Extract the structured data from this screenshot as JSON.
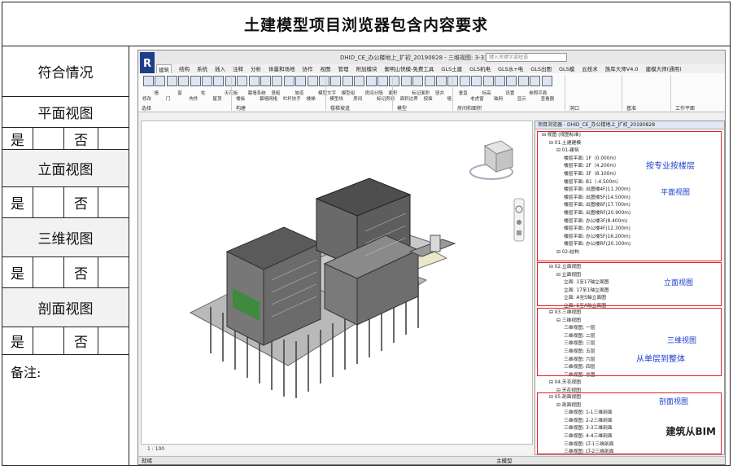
{
  "title": "土建模型项目浏览器包含内容要求",
  "left_panel": {
    "header": "符合情况",
    "sections": [
      {
        "label": "平面视图",
        "yes": "是",
        "no": "否"
      },
      {
        "label": "立面视图",
        "yes": "是",
        "no": "否"
      },
      {
        "label": "三维视图",
        "yes": "是",
        "no": "否"
      },
      {
        "label": "剖面视图",
        "yes": "是",
        "no": "否"
      }
    ],
    "note": "备注:"
  },
  "revit": {
    "logo": "R",
    "window_title": "DHID_CE_办公楼地上_扩初_20190828 - 三维视图: 3-3三维剖面",
    "search_placeholder": "键入关键字或短语",
    "tabs": [
      "建筑",
      "结构",
      "系统",
      "插入",
      "注释",
      "分析",
      "体量和场地",
      "协作",
      "视图",
      "管理",
      "附加模块",
      "衡明山快模-免费工具",
      "GLS土建",
      "GLS机电",
      "GLS水+电",
      "GLS出图",
      "GLS模",
      "云技术",
      "族库大师V4.0",
      "建模大师(通用)"
    ],
    "active_tab": "建筑",
    "ribbon_buttons": [
      "修改",
      "墙",
      "门",
      "窗",
      "构件",
      "柱",
      "屋顶",
      "天花板",
      "楼板",
      "幕墙系统",
      "幕墙网格",
      "竖梃",
      "栏杆扶手",
      "坡道",
      "楼梯",
      "模型文字",
      "模型线",
      "模型组",
      "房间",
      "房间分隔",
      "标记房间",
      "面积",
      "面积边界",
      "标记面积",
      "按面",
      "竖井",
      "墙",
      "垂直",
      "老虎窗",
      "标高",
      "轴网",
      "设置",
      "显示",
      "参照平面",
      "查看器"
    ],
    "ribbon_groups": [
      "选择",
      "构建",
      "楼梯坡道",
      "模型",
      "房间和面积",
      "洞口",
      "基准",
      "工作平面"
    ],
    "view_scale": "1 : 100",
    "status": "就绪",
    "status_right": "主模型",
    "browser": {
      "header": "项目浏览器 - DHID_CE_办公楼地上_扩初_20190828",
      "items": [
        "视图 (视图标准)",
        "01.土建建模",
        "01-建筑",
        "楼层平面: 1F（0.000m）",
        "楼层平面: 2F（4.200m）",
        "楼层平面: 3F（8.100m）",
        "楼层平面: B1（-4.500m）",
        "楼层平面: 出图楼4F(11.300m)",
        "楼层平面: 出图楼5F(14.500m)",
        "楼层平面: 出图楼6F(17.700m)",
        "楼层平面: 出图楼RF(20.900m)",
        "楼层平面: 办公楼3F(8.400m)",
        "楼层平面: 办公楼4F(12.300m)",
        "楼层平面: 办公楼5F(16.200m)",
        "楼层平面: 办公楼RF(20.100m)",
        "02-结构",
        "02.立面视图",
        "立面视图",
        "立面: 1至17轴立面图",
        "立面: 17至1轴立面图",
        "立面: A至S轴立面图",
        "立面: S至A轴立面图",
        "03.三维视图",
        "三维视图",
        "三维视图: 一层",
        "三维视图: 二层",
        "三维视图: 三层",
        "三维视图: 五层",
        "三维视图: 六层",
        "三维视图: 四层",
        "三维视图: 总图",
        "04.天花视图",
        "天花视图",
        "05.剖面视图",
        "剖面视图",
        "三维视图: 1-1三维剖面",
        "三维视图: 2-2三维剖面",
        "三维视图: 3-3三维剖面",
        "三维视图: 4-4三维剖面",
        "三维视图: LT-1三维剖面",
        "三维视图: LT-2三维剖面"
      ]
    },
    "annotations": {
      "by_discipline": "按专业按楼层",
      "plan": "平面视图",
      "elevation": "立面视图",
      "threed": "三维视图",
      "single_to_whole": "从单层到整体",
      "section": "剖面视图"
    },
    "watermark": "建筑从BIM"
  },
  "colors": {
    "annotation_red": "#e0202a",
    "annotation_blue": "#1a3ecf",
    "revit_blue": "#1d3f8a"
  }
}
